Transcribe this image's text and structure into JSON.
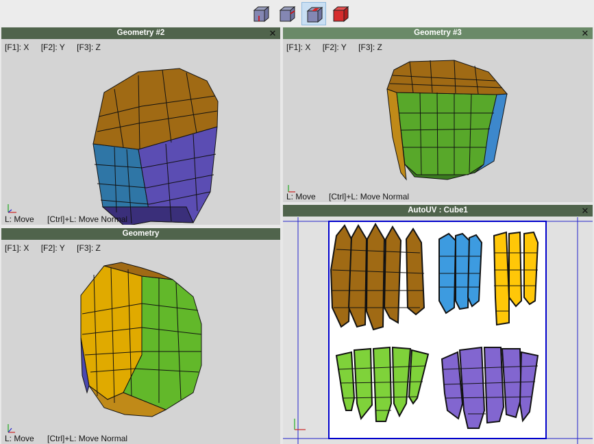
{
  "toolbar": {
    "buttons": [
      {
        "icon": "view-cube-front-icon",
        "active": false
      },
      {
        "icon": "view-cube-side-icon",
        "active": false
      },
      {
        "icon": "view-cube-top-icon",
        "active": true
      },
      {
        "icon": "view-cube-red-icon",
        "active": false
      }
    ]
  },
  "panels": {
    "geometry2": {
      "title": "Geometry #2",
      "keys": [
        "[F1]: X",
        "[F2]: Y",
        "[F3]: Z"
      ],
      "status": [
        "L: Move",
        "[Ctrl]+L: Move Normal"
      ]
    },
    "geometry3": {
      "title": "Geometry #3",
      "keys": [
        "[F1]: X",
        "[F2]: Y",
        "[F3]: Z"
      ],
      "status": [
        "L: Move",
        "[Ctrl]+L: Move Normal"
      ]
    },
    "geometry": {
      "title": "Geometry",
      "keys": [
        "[F1]: X",
        "[F2]: Y",
        "[F3]: Z"
      ],
      "status": [
        "L: Move",
        "[Ctrl]+L: Move Normal"
      ]
    },
    "autouv": {
      "title": "AutoUV : Cube1"
    }
  },
  "colors": {
    "title_bar": "#50644c",
    "brown": "#a06a14",
    "blue": "#3d9be0",
    "yellow": "#ffc708",
    "green": "#7fd23a",
    "purple": "#8266d0",
    "uv_frame": "#0000cc"
  }
}
